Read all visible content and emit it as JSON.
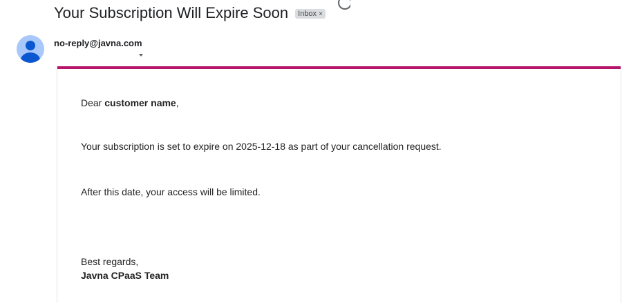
{
  "email": {
    "subject": "Your Subscription Will Expire Soon",
    "label_chip": "Inbox",
    "label_remove": "×",
    "sender": "no-reply@javna.com"
  },
  "body": {
    "greeting_prefix": "Dear ",
    "customer_name": "customer name",
    "greeting_suffix": ",",
    "line1": "Your subscription is set to expire on 2025-12-18 as part of your cancellation request.",
    "line2": "After this date, your access will be limited.",
    "closing": "Best regards,",
    "signature": "Javna CPaaS Team"
  },
  "colors": {
    "accent_bar": "#b5166b",
    "avatar_bg": "#a8c7fa",
    "avatar_fg": "#0b57d0"
  },
  "icons": {
    "avatar": "person-avatar-icon",
    "details": "chevron-down-icon",
    "loading": "loading-spinner-icon"
  }
}
